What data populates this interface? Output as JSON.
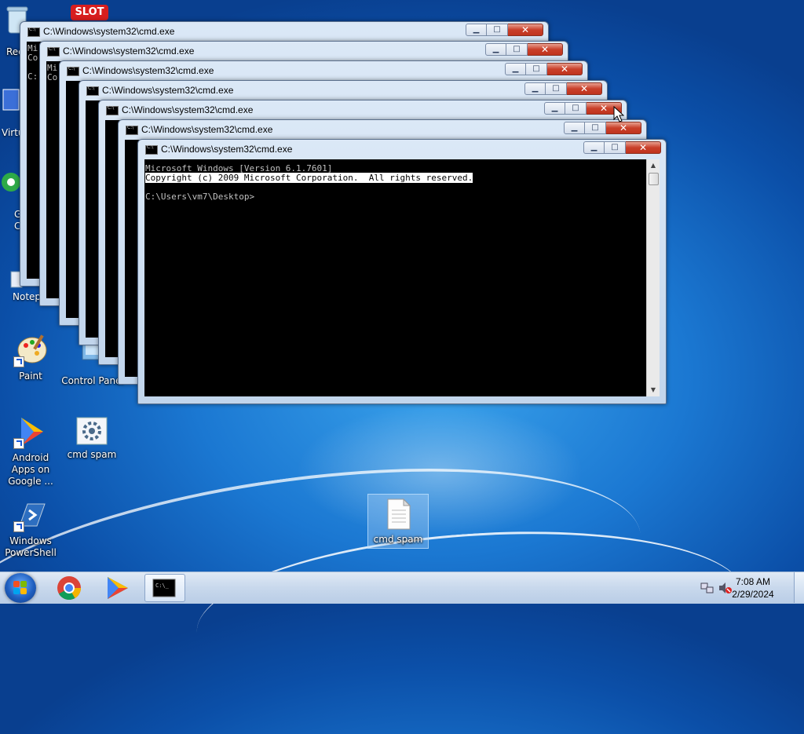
{
  "desktop": {
    "icons": [
      {
        "id": "recycle",
        "label": "Rec"
      },
      {
        "id": "virtu",
        "label": "Virtu"
      },
      {
        "id": "chrome-partial",
        "label": "G\nC"
      },
      {
        "id": "notepad",
        "label": "Notep"
      },
      {
        "id": "paint",
        "label": "Paint"
      },
      {
        "id": "control",
        "label": "Control Panel"
      },
      {
        "id": "android",
        "label": "Android Apps on Google ..."
      },
      {
        "id": "cmdspam-shortcut",
        "label": "cmd spam"
      },
      {
        "id": "powershell",
        "label": "Windows PowerShell"
      },
      {
        "id": "cmdspam-file",
        "label": "cmd spam"
      }
    ],
    "slot_label": "SLOT"
  },
  "windows": {
    "title": "C:\\Windows\\system32\\cmd.exe",
    "partial_lines": [
      "Mi",
      "Co",
      "C:"
    ],
    "console": {
      "line1": "Microsoft Windows [Version 6.1.7601]",
      "line2": "Copyright (c) 2009 Microsoft Corporation.  All rights reserved.",
      "line3": "",
      "line4": "C:\\Users\\vm7\\Desktop>"
    },
    "buttons": {
      "minimize": "▁",
      "maximize": "□",
      "close": "✕"
    }
  },
  "taskbar": {
    "clock": {
      "time": "7:08 AM",
      "date": "2/29/2024"
    },
    "pinned": [
      {
        "id": "chrome",
        "icon": "chrome-icon"
      },
      {
        "id": "play",
        "icon": "play-store-icon"
      },
      {
        "id": "cmd",
        "icon": "cmd-icon"
      }
    ]
  }
}
